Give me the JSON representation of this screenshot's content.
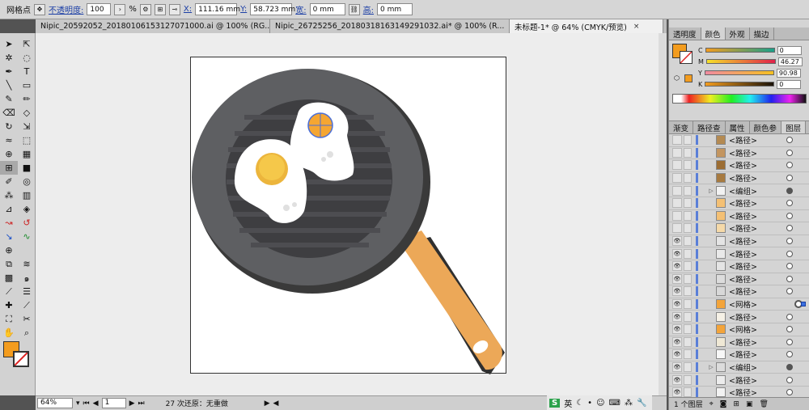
{
  "control_bar": {
    "mode_label": "网格点",
    "opacity_label": "不透明度:",
    "opacity_value": "100",
    "percent": "%",
    "x_label": "X:",
    "x_value": "111.16 mm",
    "y_label": "Y:",
    "y_value": "58.723 mm",
    "w_label": "宽:",
    "w_value": "0 mm",
    "h_label": "高:",
    "h_value": "0 mm"
  },
  "doc_tabs": [
    {
      "label": "Nipic_20592052_20180106153127071000.ai @ 100% (RG...",
      "active": false
    },
    {
      "label": "Nipic_26725256_20180318163149291032.ai* @ 100% (R...",
      "active": false
    },
    {
      "label": "未标题-1* @ 64% (CMYK/预览)",
      "active": true
    }
  ],
  "close_glyph": "×",
  "status_bar": {
    "zoom": "64%",
    "page": "1",
    "undo_text": "27 次还原：无重做"
  },
  "color_panel": {
    "tabs": [
      "透明度",
      "颜色",
      "外观",
      "描边"
    ],
    "active_tab": "颜色",
    "fill_color": "#f39c1e",
    "channels": [
      {
        "name": "C",
        "value": "0"
      },
      {
        "name": "M",
        "value": "46.27"
      },
      {
        "name": "Y",
        "value": "90.98"
      },
      {
        "name": "K",
        "value": "0"
      }
    ]
  },
  "layers_panel": {
    "tabs": [
      "渐变",
      "路径查",
      "属性",
      "颜色参",
      "图层"
    ],
    "active_tab": "图层",
    "rows": [
      {
        "name": "<路径>",
        "eye": false,
        "expand": false,
        "target": "empty",
        "thumb": "#b48a52"
      },
      {
        "name": "<路径>",
        "eye": false,
        "expand": false,
        "target": "empty",
        "thumb": "#c39560"
      },
      {
        "name": "<路径>",
        "eye": false,
        "expand": false,
        "target": "empty",
        "thumb": "#9c6d33"
      },
      {
        "name": "<路径>",
        "eye": false,
        "expand": false,
        "target": "empty",
        "thumb": "#a77a40"
      },
      {
        "name": "<编组>",
        "eye": false,
        "expand": true,
        "target": "filled",
        "thumb": "#f2f2f2"
      },
      {
        "name": "<路径>",
        "eye": false,
        "expand": false,
        "target": "empty",
        "thumb": "#f4c074"
      },
      {
        "name": "<路径>",
        "eye": false,
        "expand": false,
        "target": "empty",
        "thumb": "#f4c074"
      },
      {
        "name": "<路径>",
        "eye": false,
        "expand": false,
        "target": "empty",
        "thumb": "#f5d9a8"
      },
      {
        "name": "<路径>",
        "eye": true,
        "expand": false,
        "target": "empty",
        "thumb": "#e4e4e4"
      },
      {
        "name": "<路径>",
        "eye": true,
        "expand": false,
        "target": "empty",
        "thumb": "#e9e9e9"
      },
      {
        "name": "<路径>",
        "eye": true,
        "expand": false,
        "target": "empty",
        "thumb": "#e4e4e4"
      },
      {
        "name": "<路径>",
        "eye": true,
        "expand": false,
        "target": "empty",
        "thumb": "#dcdcdc"
      },
      {
        "name": "<路径>",
        "eye": true,
        "expand": false,
        "target": "empty",
        "thumb": "#d8d8d8"
      },
      {
        "name": "<网格>",
        "eye": true,
        "expand": false,
        "target": "selected",
        "thumb": "#f3a43a"
      },
      {
        "name": "<路径>",
        "eye": true,
        "expand": false,
        "target": "empty",
        "thumb": "#f6f1e6"
      },
      {
        "name": "<网格>",
        "eye": true,
        "expand": false,
        "target": "empty",
        "thumb": "#f3a43a"
      },
      {
        "name": "<路径>",
        "eye": true,
        "expand": false,
        "target": "empty",
        "thumb": "#efe8d5"
      },
      {
        "name": "<路径>",
        "eye": true,
        "expand": false,
        "target": "empty",
        "thumb": "#f7f7f7"
      },
      {
        "name": "<编组>",
        "eye": true,
        "expand": true,
        "target": "filled",
        "thumb": "#dcdcdc"
      },
      {
        "name": "<路径>",
        "eye": true,
        "expand": false,
        "target": "empty",
        "thumb": "#ececec"
      },
      {
        "name": "<路径>",
        "eye": true,
        "expand": false,
        "target": "empty",
        "thumb": "#f2f2f2"
      }
    ],
    "bottom_label": "1 个图层"
  },
  "ime": {
    "lang": "英"
  }
}
